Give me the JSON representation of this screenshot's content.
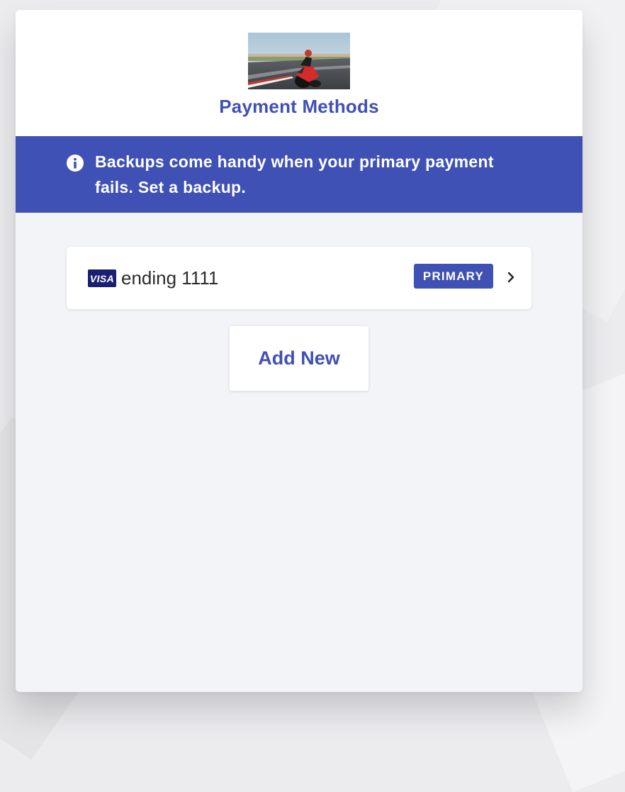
{
  "header": {
    "title": "Payment Methods",
    "image_subject": "motorcycle rider on race track"
  },
  "banner": {
    "icon": "info-icon",
    "message": "Backups come handy when your primary payment fails. Set a backup."
  },
  "payment_methods": [
    {
      "brand": "VISA",
      "label": "ending 1111",
      "badge": "PRIMARY",
      "action_icon": "chevron-right-icon"
    }
  ],
  "actions": {
    "add_new_label": "Add New"
  },
  "colors": {
    "accent": "#3f51b5",
    "card_background": "#f3f4f7",
    "header_background": "#ffffff",
    "visa_blue": "#1a1f71"
  }
}
